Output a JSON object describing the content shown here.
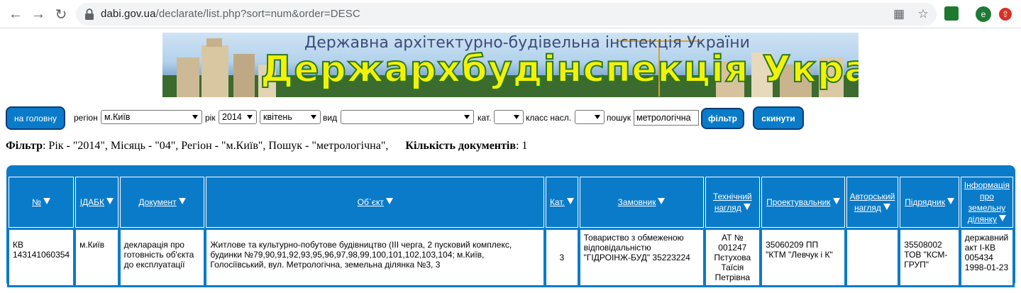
{
  "browser": {
    "url_host": "dabi.gov.ua",
    "url_path": "/declarate/list.php?sort=num&order=DESC",
    "profile_initial": "e"
  },
  "banner": {
    "subtitle": "Державна архітектурно-будівельна інспекція України",
    "title": "Держархбудінспекція України"
  },
  "filterbar": {
    "home_button": "на головну",
    "region_label": "регіон",
    "region_value": "м.Київ",
    "year_label": "рік",
    "year_value": "2014",
    "month_value": "квітень",
    "kind_label": "вид",
    "kind_value": "",
    "cat_label": "кат.",
    "cat_value": "",
    "class_label": "класс насл.",
    "class_value": "",
    "search_label": "пошук",
    "search_value": "метрологічна",
    "filter_button": "фільтр",
    "reset_button": "скинути"
  },
  "summary": {
    "filter_label": "Фільтр",
    "filter_text": ": Рік - \"2014\", Місяць - \"04\", Регіон - \"м.Київ\", Пошук - \"метрологічна\",",
    "count_label": "Кількість документів",
    "count_value": ": 1"
  },
  "table": {
    "headers": [
      "№",
      "ІДАБК",
      "Документ",
      "Об`єкт",
      "Кат.",
      "Замовник",
      "Технічний нагляд",
      "Проектувальник",
      "Авторський нагляд",
      "Підрядник",
      "Інформація про земельну ділянку"
    ],
    "rows": [
      {
        "num": "КВ 143141060354",
        "idabk": "м.Київ",
        "document": "декларація про готовність об'єкта до експлуатації",
        "object": "Житлове та культурно-побутове будівництво (ІІІ черга, 2 пусковий комплекс, будинки №79,90,91,92,93,95,96,97,98,99,100,101,102,103,104; м.Київ, Голосіївський, вул. Метрологічна, земельна ділянка №3, 3",
        "cat": "3",
        "customer": "Товариство з обмеженою відповідальністю \"ГІДРОІНЖ-БУД\" 35223224",
        "tech_supervision": "АТ № 001247 Пєтухова Таїсія Петрівна",
        "designer": "35060209 ПП \"КТМ \"Левчук і К\"",
        "author_supervision": "",
        "contractor": "35508002 ТОВ \"КСМ-ГРУП\"",
        "land_info": "державний акт І-КВ 005434 1998-01-23"
      }
    ]
  }
}
